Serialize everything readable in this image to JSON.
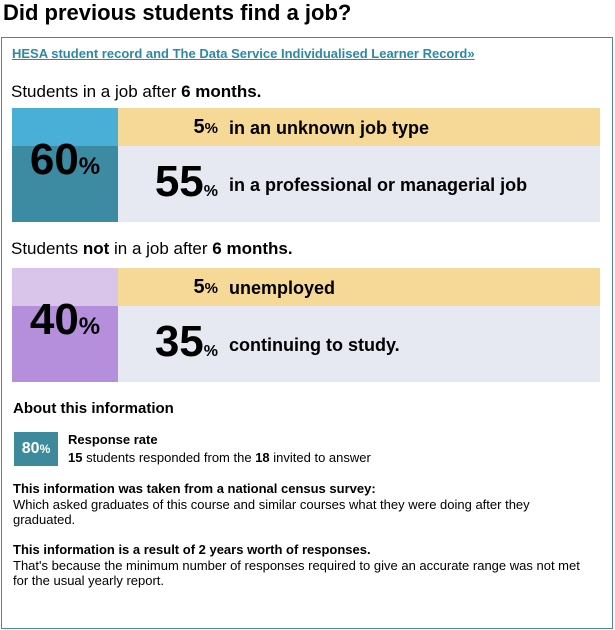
{
  "title": "Did previous students find a job?",
  "source_link": "HESA student record and The Data Service Individualised Learner Record»",
  "employed": {
    "heading_pre": "Students in a job after ",
    "heading_bold": "6 months.",
    "total": "60",
    "total_pct": "%",
    "rows": [
      {
        "value": "5",
        "pct": "%",
        "label": "in an unknown job type"
      },
      {
        "value": "55",
        "pct": "%",
        "label": "in a professional or managerial job"
      }
    ],
    "colors": {
      "left_top": "#4aafd6",
      "left_bottom": "#3d8aa3"
    }
  },
  "not_employed": {
    "heading_pre": "Students ",
    "heading_not": "not",
    "heading_mid": " in a job after ",
    "heading_bold": "6 months.",
    "total": "40",
    "total_pct": "%",
    "rows": [
      {
        "value": "5",
        "pct": "%",
        "label": "unemployed"
      },
      {
        "value": "35",
        "pct": "%",
        "label": "continuing to study."
      }
    ],
    "colors": {
      "left_top": "#d9c4ea",
      "left_bottom": "#b68fdc"
    }
  },
  "about": {
    "title": "About this information",
    "response_rate": {
      "value": "80",
      "pct": "%",
      "title": "Response rate",
      "responded": "15",
      "mid_text": " students responded from the ",
      "invited": "18",
      "end_text": " invited to answer"
    },
    "info": [
      {
        "title": "This information was taken from a national census survey:",
        "text": "Which asked graduates of this course and similar courses what they were doing after they graduated."
      },
      {
        "title": "This information is a result of 2 years worth of responses.",
        "text": "That's because the minimum number of responses required to give an accurate range was not met for the usual yearly report."
      }
    ]
  }
}
